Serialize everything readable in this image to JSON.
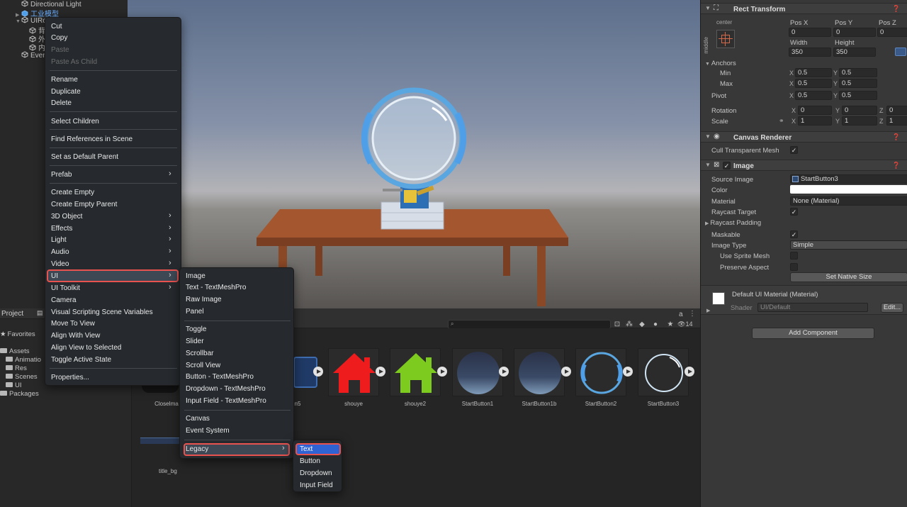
{
  "hierarchy": {
    "rows": [
      {
        "label": "Directional Light"
      },
      {
        "label": "工业模型"
      },
      {
        "label": "UIRo"
      },
      {
        "label": "背"
      },
      {
        "label": "外"
      },
      {
        "label": "内"
      },
      {
        "label": "Even"
      }
    ]
  },
  "project": {
    "tab_label": "Project",
    "tree": {
      "favorites": "Favorites",
      "assets": "Assets",
      "folders": [
        "Animatio",
        "Res",
        "Scenes",
        "UI"
      ],
      "packages": "Packages"
    },
    "hidden_count": "14",
    "assets": [
      {
        "label": "CloseIma"
      },
      {
        "label": "n5"
      },
      {
        "label": "shouye"
      },
      {
        "label": "shouye2"
      },
      {
        "label": "StartButton1"
      },
      {
        "label": "StartButton1b"
      },
      {
        "label": "StartButton2"
      },
      {
        "label": "StartButton3"
      },
      {
        "label": "title_bg"
      }
    ]
  },
  "context_menu": {
    "items": [
      {
        "label": "Cut"
      },
      {
        "label": "Copy"
      },
      {
        "label": "Paste"
      },
      {
        "label": "Paste As Child"
      },
      {
        "label": "Rename"
      },
      {
        "label": "Duplicate"
      },
      {
        "label": "Delete"
      },
      {
        "label": "Select Children"
      },
      {
        "label": "Find References in Scene"
      },
      {
        "label": "Set as Default Parent"
      },
      {
        "label": "Prefab"
      },
      {
        "label": "Create Empty"
      },
      {
        "label": "Create Empty Parent"
      },
      {
        "label": "3D Object"
      },
      {
        "label": "Effects"
      },
      {
        "label": "Light"
      },
      {
        "label": "Audio"
      },
      {
        "label": "Video"
      },
      {
        "label": "UI"
      },
      {
        "label": "UI Toolkit"
      },
      {
        "label": "Camera"
      },
      {
        "label": "Visual Scripting Scene Variables"
      },
      {
        "label": "Move To View"
      },
      {
        "label": "Align With View"
      },
      {
        "label": "Align View to Selected"
      },
      {
        "label": "Toggle Active State"
      },
      {
        "label": "Properties..."
      }
    ]
  },
  "ui_submenu": {
    "items": [
      {
        "label": "Image"
      },
      {
        "label": "Text - TextMeshPro"
      },
      {
        "label": "Raw Image"
      },
      {
        "label": "Panel"
      },
      {
        "label": "Toggle"
      },
      {
        "label": "Slider"
      },
      {
        "label": "Scrollbar"
      },
      {
        "label": "Scroll View"
      },
      {
        "label": "Button - TextMeshPro"
      },
      {
        "label": "Dropdown - TextMeshPro"
      },
      {
        "label": "Input Field - TextMeshPro"
      },
      {
        "label": "Canvas"
      },
      {
        "label": "Event System"
      },
      {
        "label": "Legacy"
      }
    ]
  },
  "legacy_submenu": {
    "items": [
      {
        "label": "Text"
      },
      {
        "label": "Button"
      },
      {
        "label": "Dropdown"
      },
      {
        "label": "Input Field"
      }
    ]
  },
  "inspector": {
    "rect_transform": {
      "title": "Rect Transform",
      "anchor_preset_h": "center",
      "anchor_preset_v": "middle",
      "pos_x_label": "Pos X",
      "pos_y_label": "Pos Y",
      "pos_z_label": "Pos Z",
      "pos_x": "0",
      "pos_y": "0",
      "pos_z": "0",
      "width_label": "Width",
      "height_label": "Height",
      "width": "350",
      "height": "350",
      "anchors_label": "Anchors",
      "min_label": "Min",
      "max_label": "Max",
      "pivot_label": "Pivot",
      "x": "X",
      "y": "Y",
      "z": "Z",
      "min_x": "0.5",
      "min_y": "0.5",
      "max_x": "0.5",
      "max_y": "0.5",
      "pivot_x": "0.5",
      "pivot_y": "0.5",
      "rotation_label": "Rotation",
      "rot_x": "0",
      "rot_y": "0",
      "rot_z": "0",
      "scale_label": "Scale",
      "scale_x": "1",
      "scale_y": "1",
      "scale_z": "1"
    },
    "canvas_renderer": {
      "title": "Canvas Renderer",
      "cull_label": "Cull Transparent Mesh"
    },
    "image": {
      "title": "Image",
      "source_image_label": "Source Image",
      "source_image": "StartButton3",
      "color_label": "Color",
      "material_label": "Material",
      "material": "None (Material)",
      "raycast_target_label": "Raycast Target",
      "raycast_padding_label": "Raycast Padding",
      "maskable_label": "Maskable",
      "image_type_label": "Image Type",
      "image_type": "Simple",
      "use_sprite_mesh_label": "Use Sprite Mesh",
      "preserve_aspect_label": "Preserve Aspect",
      "set_native_size": "Set Native Size"
    },
    "material_section": {
      "name": "Default UI Material (Material)",
      "shader_label": "Shader",
      "shader": "UI/Default",
      "edit_button": "Edit..."
    },
    "add_component": "Add Component"
  },
  "colors": {
    "menu_highlight": "#e8524f",
    "selection_blue": "#2f63d4",
    "ui_blue_ring": "#5aa6e0"
  }
}
